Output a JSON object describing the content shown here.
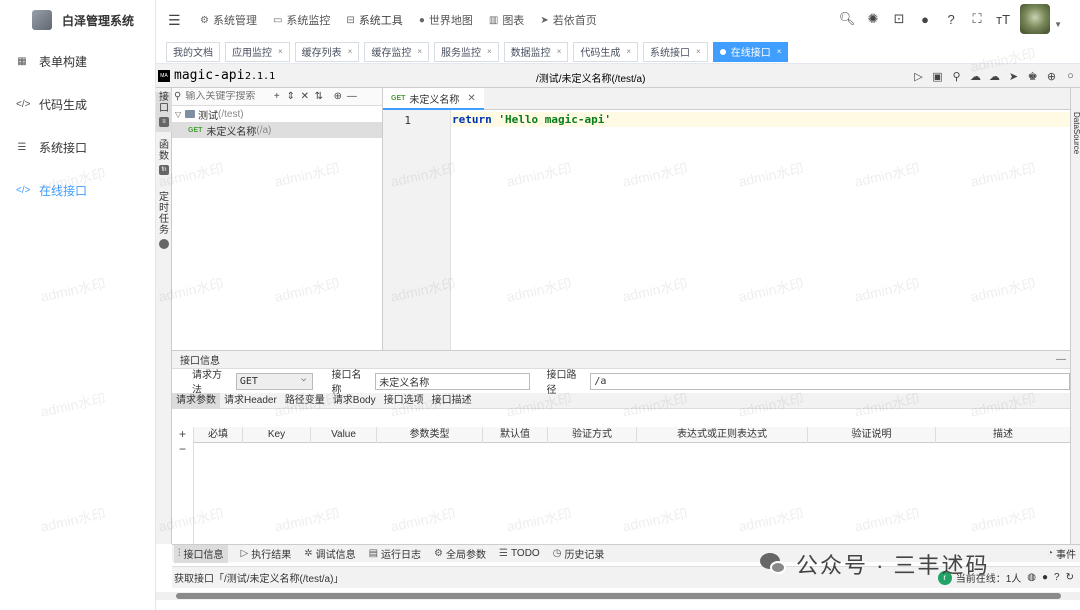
{
  "app": {
    "title": "白泽管理系统"
  },
  "sidebar": {
    "items": [
      {
        "label": "表单构建",
        "icon": "table-icon"
      },
      {
        "label": "代码生成",
        "icon": "code-icon"
      },
      {
        "label": "系统接口",
        "icon": "sliders-icon"
      },
      {
        "label": "在线接口",
        "icon": "code-icon",
        "active": true
      }
    ]
  },
  "navbar": {
    "menus": [
      {
        "label": "系统管理",
        "icon": "gear-icon"
      },
      {
        "label": "系统监控",
        "icon": "monitor-icon"
      },
      {
        "label": "系统工具",
        "icon": "toolbox-icon"
      },
      {
        "label": "世界地图",
        "icon": "globe-icon"
      },
      {
        "label": "图表",
        "icon": "bar-chart-icon"
      },
      {
        "label": "若依首页",
        "icon": "send-icon"
      }
    ]
  },
  "tags": [
    {
      "label": "我的文档"
    },
    {
      "label": "应用监控"
    },
    {
      "label": "缓存列表"
    },
    {
      "label": "缓存监控"
    },
    {
      "label": "服务监控"
    },
    {
      "label": "数据监控"
    },
    {
      "label": "代码生成"
    },
    {
      "label": "系统接口"
    },
    {
      "label": "在线接口",
      "active": true
    }
  ],
  "magic": {
    "logo_text": "MA",
    "title": "magic-api",
    "version": "2.1.1",
    "path": "/测试/未定义名称(/test/a)",
    "vtabs": {
      "api": "接口",
      "func": "函数",
      "func_badge": "fn",
      "task": "定时任务"
    },
    "right_tab": "DataSource",
    "tree": {
      "search_placeholder": "输入关键字搜索",
      "group_name": "测试",
      "group_path": "(/test)",
      "item_method": "GET",
      "item_name": "未定义名称",
      "item_path": "(/a)"
    },
    "editor": {
      "tab_method": "GET",
      "tab_name": "未定义名称",
      "line_no": "1",
      "code_kw": "return",
      "code_str": "'Hello magic-api'"
    },
    "info": {
      "title": "接口信息",
      "method_label": "请求方法",
      "method_value": "GET",
      "name_label": "接口名称",
      "name_value": "未定义名称",
      "path_label": "接口路径",
      "path_value": "/a"
    },
    "param_tabs": [
      "请求参数",
      "请求Header",
      "路径变量",
      "请求Body",
      "接口选项",
      "接口描述"
    ],
    "table_headers": [
      "必填",
      "Key",
      "Value",
      "参数类型",
      "默认值",
      "验证方式",
      "表达式或正则表达式",
      "验证说明",
      "描述"
    ],
    "status_tabs": [
      {
        "label": "接口信息",
        "icon": "info-icon"
      },
      {
        "label": "执行结果",
        "icon": "play-icon"
      },
      {
        "label": "调试信息",
        "icon": "bug-icon"
      },
      {
        "label": "运行日志",
        "icon": "log-icon"
      },
      {
        "label": "全局参数",
        "icon": "gear-icon"
      },
      {
        "label": "TODO",
        "icon": "list-icon"
      },
      {
        "label": "历史记录",
        "icon": "history-icon"
      },
      {
        "label": "事件",
        "icon": "clock-icon"
      }
    ],
    "status": {
      "fetch_text": "获取接口「/测试/未定义名称(/test/a)」",
      "online_label": "当前在线：1人"
    }
  },
  "watermark": "admin水印",
  "overlay": {
    "text": "公众号 · 三丰述码"
  }
}
